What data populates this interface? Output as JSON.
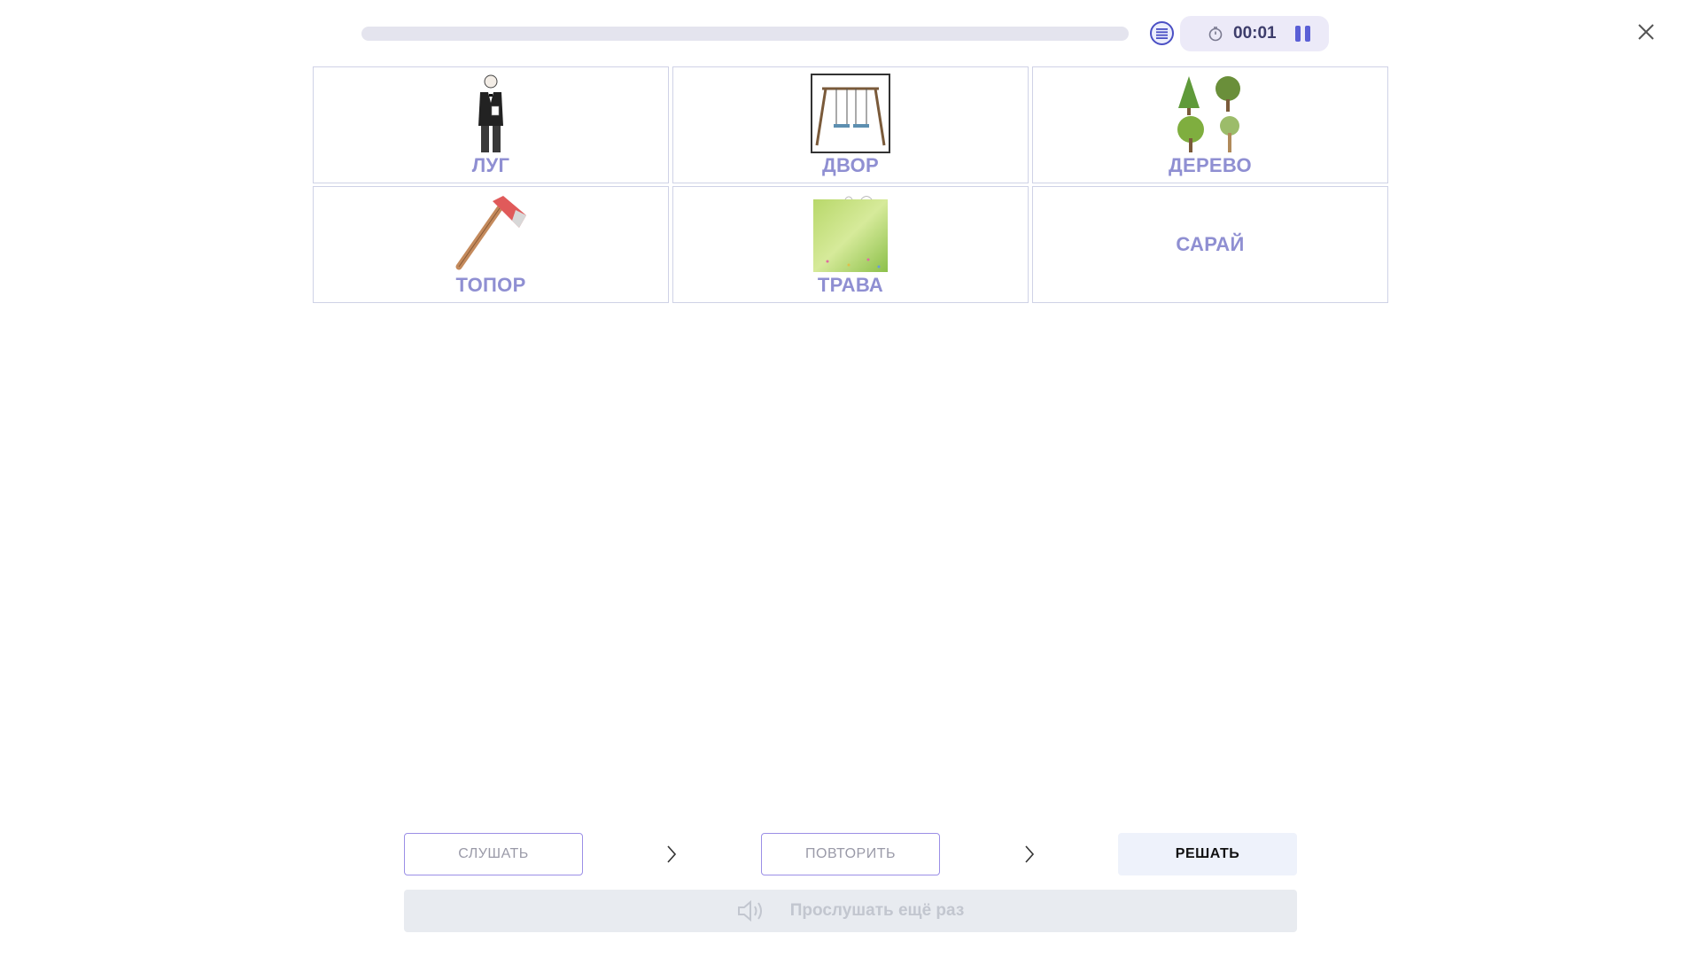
{
  "header": {
    "progress_fraction": 0.0,
    "timer": "00:01",
    "icons": {
      "list": "list-icon",
      "clock": "stopwatch-icon",
      "pause": "pause-icon",
      "close": "close-icon"
    }
  },
  "cards": [
    {
      "word": "ЛУГ",
      "image": "man-in-tuxedo"
    },
    {
      "word": "ДВОР",
      "image": "swing-set"
    },
    {
      "word": "ДЕРЕВО",
      "image": "trees"
    },
    {
      "word": "ТОПОР",
      "image": "axe"
    },
    {
      "word": "ТРАВА",
      "image": "grass-field"
    },
    {
      "word": "САРАЙ",
      "image": ""
    }
  ],
  "steps": {
    "listen": "СЛУШАТЬ",
    "repeat": "ПОВТОРИТЬ",
    "solve": "РЕШАТЬ"
  },
  "listen_again": {
    "label": "Прослушать ещё раз",
    "icon": "speaker-icon"
  },
  "colors": {
    "accent": "#5a5fd6",
    "word": "#8f8fd2",
    "card_border": "#cfd2e6",
    "outline": "#9b8fe6"
  }
}
